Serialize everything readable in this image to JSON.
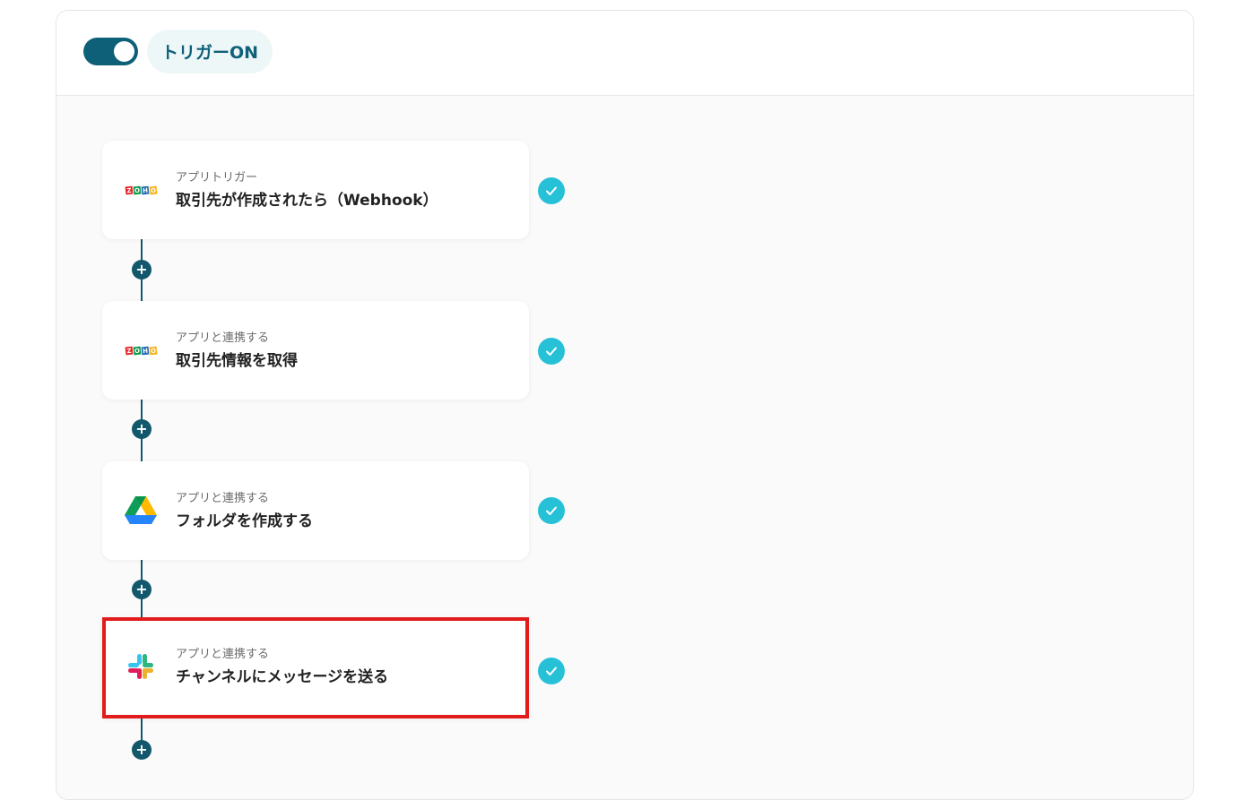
{
  "header": {
    "trigger_label": "トリガーON",
    "toggle_on": true
  },
  "steps": [
    {
      "kind": "アプリトリガー",
      "title": "取引先が作成されたら（Webhook）",
      "app_icon": "zoho-crm-icon",
      "status": "completed"
    },
    {
      "kind": "アプリと連携する",
      "title": "取引先情報を取得",
      "app_icon": "zoho-crm-icon",
      "status": "completed"
    },
    {
      "kind": "アプリと連携する",
      "title": "フォルダを作成する",
      "app_icon": "google-drive-icon",
      "status": "completed"
    },
    {
      "kind": "アプリと連携する",
      "title": "チャンネルにメッセージを送る",
      "app_icon": "slack-icon",
      "status": "completed",
      "highlighted": true
    }
  ],
  "zoho_logo": {
    "letters": [
      "Z",
      "O",
      "H",
      "O"
    ]
  },
  "colors": {
    "toggle": "#0e6079",
    "connector": "#12576b",
    "check": "#26c1d6",
    "highlight": "#e21c1c",
    "zoho": [
      "#e42527",
      "#089949",
      "#226db4",
      "#f9b21d"
    ]
  },
  "add_step_label": "+"
}
